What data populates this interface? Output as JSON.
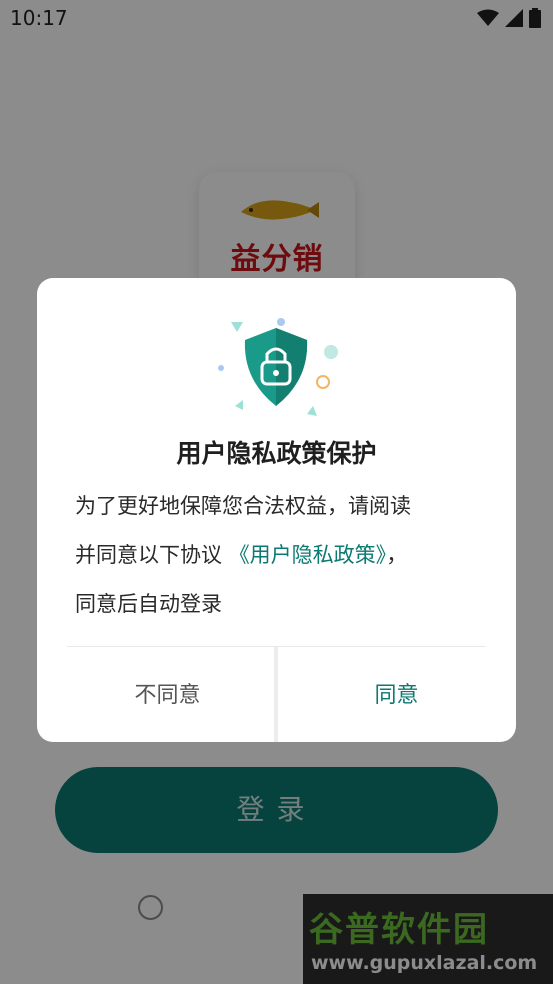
{
  "status_bar": {
    "time": "10:17"
  },
  "app": {
    "logo_text": "益分销"
  },
  "login": {
    "label": "登录"
  },
  "dialog": {
    "title": "用户隐私政策保护",
    "body_line1": "为了更好地保障您合法权益，请阅读",
    "body_line2_prefix": "并同意以下协议",
    "policy_link": "《用户隐私政策》",
    "body_line2_suffix": "，",
    "body_line3": "同意后自动登录",
    "disagree_label": "不同意",
    "agree_label": "同意"
  },
  "watermark": {
    "title": "谷普软件园",
    "url": "www.gupuxlazal.com"
  },
  "colors": {
    "accent": "#0b7a71",
    "brand_red": "#c8141b"
  }
}
